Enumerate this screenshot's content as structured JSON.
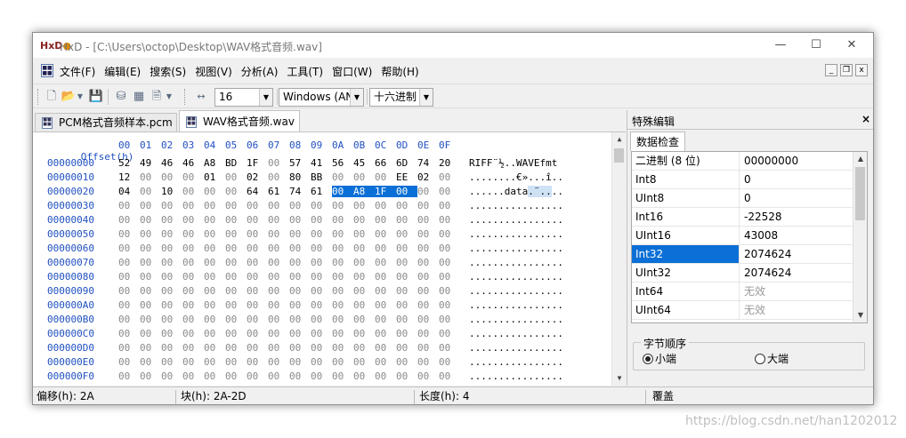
{
  "window": {
    "title": "HxD - [C:\\Users\\octop\\Desktop\\WAV格式音频.wav]",
    "app_icon_text": "HxD",
    "minimize": "—",
    "maximize": "☐",
    "close": "✕"
  },
  "menu": {
    "items": [
      "文件(F)",
      "编辑(E)",
      "搜索(S)",
      "视图(V)",
      "分析(A)",
      "工具(T)",
      "窗口(W)",
      "帮助(H)"
    ],
    "mdi_min": "_",
    "mdi_restore": "❐",
    "mdi_close": "x"
  },
  "toolbar": {
    "bytes_per_row": "16",
    "charset": "Windows (ANSI)",
    "offset_base": "十六进制",
    "combo_arrow": "▼",
    "icons": [
      "new-file-icon",
      "open-file-icon",
      "save-icon",
      "open-disk-icon",
      "open-ram-icon",
      "export-icon",
      "bytes-per-row-icon"
    ]
  },
  "tabs": [
    {
      "label": "PCM格式音频样本.pcm",
      "active": false
    },
    {
      "label": "WAV格式音频.wav",
      "active": true
    }
  ],
  "hex": {
    "header_label": "Offset(h)",
    "columns": [
      "00",
      "01",
      "02",
      "03",
      "04",
      "05",
      "06",
      "07",
      "08",
      "09",
      "0A",
      "0B",
      "0C",
      "0D",
      "0E",
      "0F"
    ],
    "rows": [
      {
        "offset": "00000000",
        "bytes": [
          "52",
          "49",
          "46",
          "46",
          "A8",
          "BD",
          "1F",
          "00",
          "57",
          "41",
          "56",
          "45",
          "66",
          "6D",
          "74",
          "20"
        ],
        "ascii": "RIFF¨½..WAVEfmt "
      },
      {
        "offset": "00000010",
        "bytes": [
          "12",
          "00",
          "00",
          "00",
          "01",
          "00",
          "02",
          "00",
          "80",
          "BB",
          "00",
          "00",
          "00",
          "EE",
          "02",
          "00"
        ],
        "ascii": "........€»...î.."
      },
      {
        "offset": "00000020",
        "bytes": [
          "04",
          "00",
          "10",
          "00",
          "00",
          "00",
          "64",
          "61",
          "74",
          "61",
          "00",
          "A8",
          "1F",
          "00",
          "00",
          "00"
        ],
        "ascii": "......data.¨...."
      },
      {
        "offset": "00000030",
        "bytes": [
          "00",
          "00",
          "00",
          "00",
          "00",
          "00",
          "00",
          "00",
          "00",
          "00",
          "00",
          "00",
          "00",
          "00",
          "00",
          "00"
        ],
        "ascii": "................"
      },
      {
        "offset": "00000040",
        "bytes": [
          "00",
          "00",
          "00",
          "00",
          "00",
          "00",
          "00",
          "00",
          "00",
          "00",
          "00",
          "00",
          "00",
          "00",
          "00",
          "00"
        ],
        "ascii": "................"
      },
      {
        "offset": "00000050",
        "bytes": [
          "00",
          "00",
          "00",
          "00",
          "00",
          "00",
          "00",
          "00",
          "00",
          "00",
          "00",
          "00",
          "00",
          "00",
          "00",
          "00"
        ],
        "ascii": "................"
      },
      {
        "offset": "00000060",
        "bytes": [
          "00",
          "00",
          "00",
          "00",
          "00",
          "00",
          "00",
          "00",
          "00",
          "00",
          "00",
          "00",
          "00",
          "00",
          "00",
          "00"
        ],
        "ascii": "................"
      },
      {
        "offset": "00000070",
        "bytes": [
          "00",
          "00",
          "00",
          "00",
          "00",
          "00",
          "00",
          "00",
          "00",
          "00",
          "00",
          "00",
          "00",
          "00",
          "00",
          "00"
        ],
        "ascii": "................"
      },
      {
        "offset": "00000080",
        "bytes": [
          "00",
          "00",
          "00",
          "00",
          "00",
          "00",
          "00",
          "00",
          "00",
          "00",
          "00",
          "00",
          "00",
          "00",
          "00",
          "00"
        ],
        "ascii": "................"
      },
      {
        "offset": "00000090",
        "bytes": [
          "00",
          "00",
          "00",
          "00",
          "00",
          "00",
          "00",
          "00",
          "00",
          "00",
          "00",
          "00",
          "00",
          "00",
          "00",
          "00"
        ],
        "ascii": "................"
      },
      {
        "offset": "000000A0",
        "bytes": [
          "00",
          "00",
          "00",
          "00",
          "00",
          "00",
          "00",
          "00",
          "00",
          "00",
          "00",
          "00",
          "00",
          "00",
          "00",
          "00"
        ],
        "ascii": "................"
      },
      {
        "offset": "000000B0",
        "bytes": [
          "00",
          "00",
          "00",
          "00",
          "00",
          "00",
          "00",
          "00",
          "00",
          "00",
          "00",
          "00",
          "00",
          "00",
          "00",
          "00"
        ],
        "ascii": "................"
      },
      {
        "offset": "000000C0",
        "bytes": [
          "00",
          "00",
          "00",
          "00",
          "00",
          "00",
          "00",
          "00",
          "00",
          "00",
          "00",
          "00",
          "00",
          "00",
          "00",
          "00"
        ],
        "ascii": "................"
      },
      {
        "offset": "000000D0",
        "bytes": [
          "00",
          "00",
          "00",
          "00",
          "00",
          "00",
          "00",
          "00",
          "00",
          "00",
          "00",
          "00",
          "00",
          "00",
          "00",
          "00"
        ],
        "ascii": "................"
      },
      {
        "offset": "000000E0",
        "bytes": [
          "00",
          "00",
          "00",
          "00",
          "00",
          "00",
          "00",
          "00",
          "00",
          "00",
          "00",
          "00",
          "00",
          "00",
          "00",
          "00"
        ],
        "ascii": "................"
      },
      {
        "offset": "000000F0",
        "bytes": [
          "00",
          "00",
          "00",
          "00",
          "00",
          "00",
          "00",
          "00",
          "00",
          "00",
          "00",
          "00",
          "00",
          "00",
          "00",
          "00"
        ],
        "ascii": "................"
      }
    ],
    "selection": {
      "row": 2,
      "start": 10,
      "end": 13
    }
  },
  "panel": {
    "title": "特殊编辑",
    "close": "×",
    "tab": "数据检查",
    "rows": [
      {
        "key": "二进制 (8 位)",
        "value": "00000000",
        "na": false,
        "selected": false
      },
      {
        "key": "Int8",
        "value": "0",
        "na": false,
        "selected": false
      },
      {
        "key": "UInt8",
        "value": "0",
        "na": false,
        "selected": false
      },
      {
        "key": "Int16",
        "value": "-22528",
        "na": false,
        "selected": false
      },
      {
        "key": "UInt16",
        "value": "43008",
        "na": false,
        "selected": false
      },
      {
        "key": "Int32",
        "value": "2074624",
        "na": false,
        "selected": true
      },
      {
        "key": "UInt32",
        "value": "2074624",
        "na": false,
        "selected": false
      },
      {
        "key": "Int64",
        "value": "无效",
        "na": true,
        "selected": false
      },
      {
        "key": "UInt64",
        "value": "无效",
        "na": true,
        "selected": false
      }
    ],
    "byte_order_label": "字节顺序",
    "little_endian": "小端",
    "big_endian": "大端",
    "little_selected": true
  },
  "status": {
    "offset": "偏移(h): 2A",
    "block": "块(h): 2A-2D",
    "length": "长度(h): 4",
    "mode": "覆盖"
  },
  "watermark": "https://blog.csdn.net/han1202012",
  "colors": {
    "selection": "#0a6fd6",
    "offset_text": "#2050c0",
    "ascii_highlight": "#cfe2f5"
  }
}
